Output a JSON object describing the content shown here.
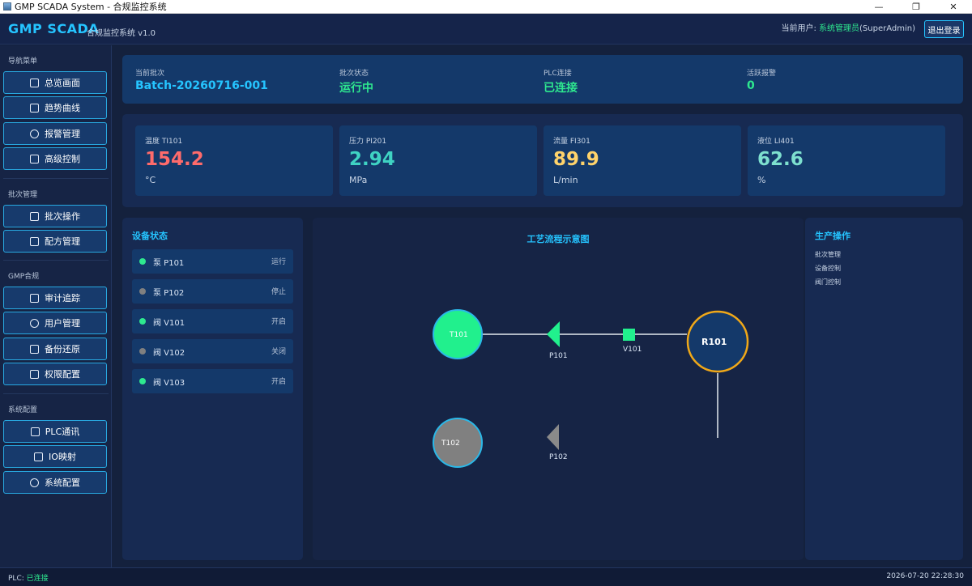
{
  "window": {
    "title": "GMP SCADA System - 合规监控系统",
    "min": "—",
    "restore": "❐",
    "close": "✕"
  },
  "header": {
    "brand": "GMP SCADA",
    "subtitle": "合规监控系统 v1.0",
    "user_prefix": "当前用户: ",
    "user_name": "系统管理员",
    "user_role": "(SuperAdmin)",
    "logout": "退出登录"
  },
  "sidebar": {
    "sections": [
      {
        "title": "导航菜单",
        "items": [
          "总览画面",
          "趋势曲线",
          "报警管理",
          "高级控制"
        ]
      },
      {
        "title": "批次管理",
        "items": [
          "批次操作",
          "配方管理"
        ]
      },
      {
        "title": "GMP合规",
        "items": [
          "审计追踪",
          "用户管理",
          "备份还原",
          "权限配置"
        ]
      },
      {
        "title": "系统配置",
        "items": [
          "PLC通讯",
          "IO映射",
          "系统配置"
        ]
      }
    ]
  },
  "batch": {
    "items": [
      {
        "label": "当前批次",
        "value": "Batch-20260716-001"
      },
      {
        "label": "批次状态",
        "value": "运行中"
      },
      {
        "label": "PLC连接",
        "value": "已连接"
      },
      {
        "label": "活跃报警",
        "value": "0"
      }
    ]
  },
  "sensors": [
    {
      "label": "温度 TI101",
      "value": "154.2",
      "unit": "°C",
      "color": "#ff6b6b"
    },
    {
      "label": "压力 PI201",
      "value": "2.94",
      "unit": "MPa",
      "color": "#3fd3c3"
    },
    {
      "label": "流量 FI301",
      "value": "89.9",
      "unit": "L/min",
      "color": "#ffd36b"
    },
    {
      "label": "液位 LI401",
      "value": "62.6",
      "unit": "%",
      "color": "#7ee0cf"
    }
  ],
  "devices": {
    "title": "设备状态",
    "rows": [
      {
        "name": "泵 P101",
        "status": "运行",
        "on": true
      },
      {
        "name": "泵 P102",
        "status": "停止",
        "on": false
      },
      {
        "name": "阀 V101",
        "status": "开启",
        "on": true
      },
      {
        "name": "阀 V102",
        "status": "关闭",
        "on": false
      },
      {
        "name": "阀 V103",
        "status": "开启",
        "on": true
      }
    ]
  },
  "process": {
    "title": "工艺流程示意图",
    "labels": {
      "t101": "T101",
      "t102": "T102",
      "r101": "R101",
      "p101": "P101",
      "p102": "P102",
      "v101": "V101"
    }
  },
  "operations": {
    "title": "生产操作",
    "items": [
      "批次管理",
      "设备控制",
      "阀门控制"
    ]
  },
  "statusbar": {
    "plc_prefix": "PLC: ",
    "plc_status": "已连接",
    "datetime": "2026-07-20 22:28:30"
  },
  "colors": {
    "accent": "#25c4ff",
    "ok": "#2ee88f",
    "off": "#808080",
    "reactor_ring": "#f0a818"
  }
}
